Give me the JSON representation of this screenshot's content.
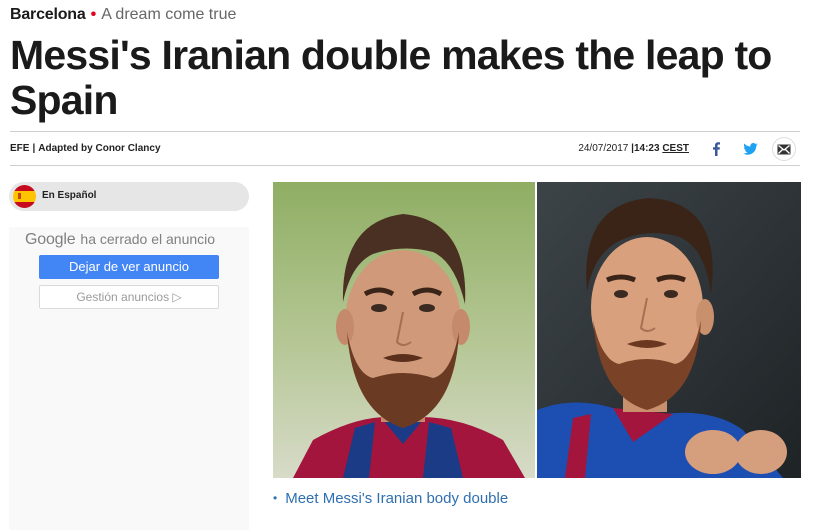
{
  "article": {
    "section": "Barcelona",
    "subsection": "A dream come true",
    "headline": "Messi's Iranian double makes the leap to Spain",
    "byline": {
      "source": "EFE",
      "separator": "|",
      "author": "Adapted by Conor Clancy"
    },
    "date": "24/07/2017",
    "time_separator": "|",
    "time": "14:23",
    "timezone": "CEST",
    "share": [
      {
        "name": "facebook-icon",
        "color": "#3b5998"
      },
      {
        "name": "twitter-icon",
        "color": "#1da1f2"
      },
      {
        "name": "email-icon",
        "color": "#333333"
      }
    ],
    "accent_color": "#e3001b"
  },
  "sidebar": {
    "language_label": "En Español",
    "ad": {
      "google_word": "Google",
      "closed_text": "ha cerrado el anuncio",
      "stop_button": "Dejar de ver anuncio",
      "manage_button": "Gestión anuncios ▷"
    }
  },
  "media": {
    "photo_name": "side-by-side-photo",
    "caption_link": "Meet Messi's Iranian body double",
    "link_color": "#2f6fb0"
  }
}
